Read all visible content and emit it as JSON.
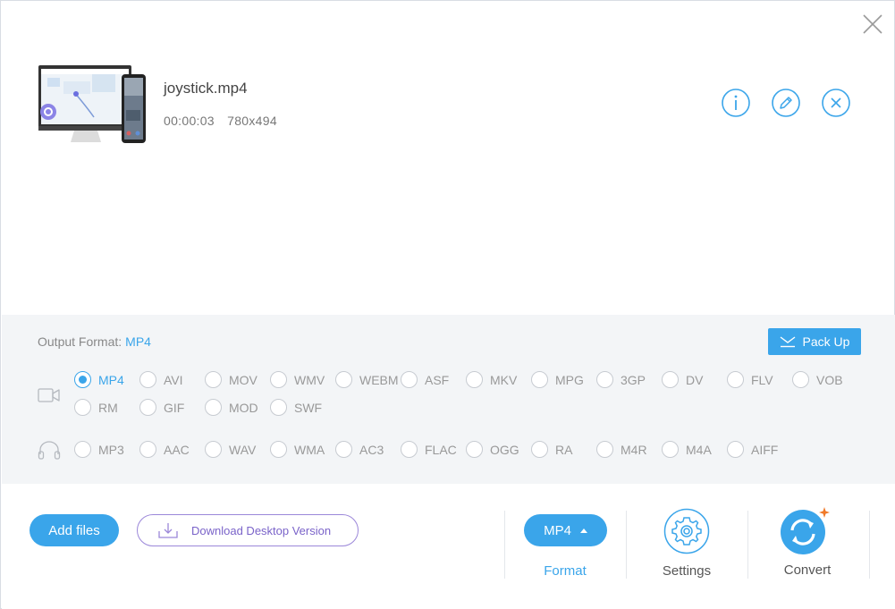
{
  "file": {
    "name": "joystick.mp4",
    "duration": "00:00:03",
    "resolution": "780x494"
  },
  "format_panel": {
    "output_label": "Output Format:",
    "output_value": "MP4",
    "packup_label": "Pack Up",
    "video_formats": [
      "MP4",
      "AVI",
      "MOV",
      "WMV",
      "WEBM",
      "ASF",
      "MKV",
      "MPG",
      "3GP",
      "DV",
      "FLV",
      "VOB",
      "RM",
      "GIF",
      "MOD",
      "SWF"
    ],
    "audio_formats": [
      "MP3",
      "AAC",
      "WAV",
      "WMA",
      "AC3",
      "FLAC",
      "OGG",
      "RA",
      "M4R",
      "M4A",
      "AIFF"
    ],
    "selected": "MP4"
  },
  "footer": {
    "add_files": "Add files",
    "download_desktop": "Download Desktop Version",
    "format_pill": "MP4",
    "format_label": "Format",
    "settings_label": "Settings",
    "convert_label": "Convert"
  },
  "colors": {
    "accent": "#3aa5ea",
    "purple": "#7a63c9",
    "panel_bg": "#f3f5f7",
    "badge_orange": "#f07a2a"
  },
  "icons": [
    "close-icon",
    "info-icon",
    "edit-icon",
    "remove-icon",
    "video-icon",
    "audio-icon",
    "download-icon",
    "settings-icon",
    "convert-icon"
  ]
}
